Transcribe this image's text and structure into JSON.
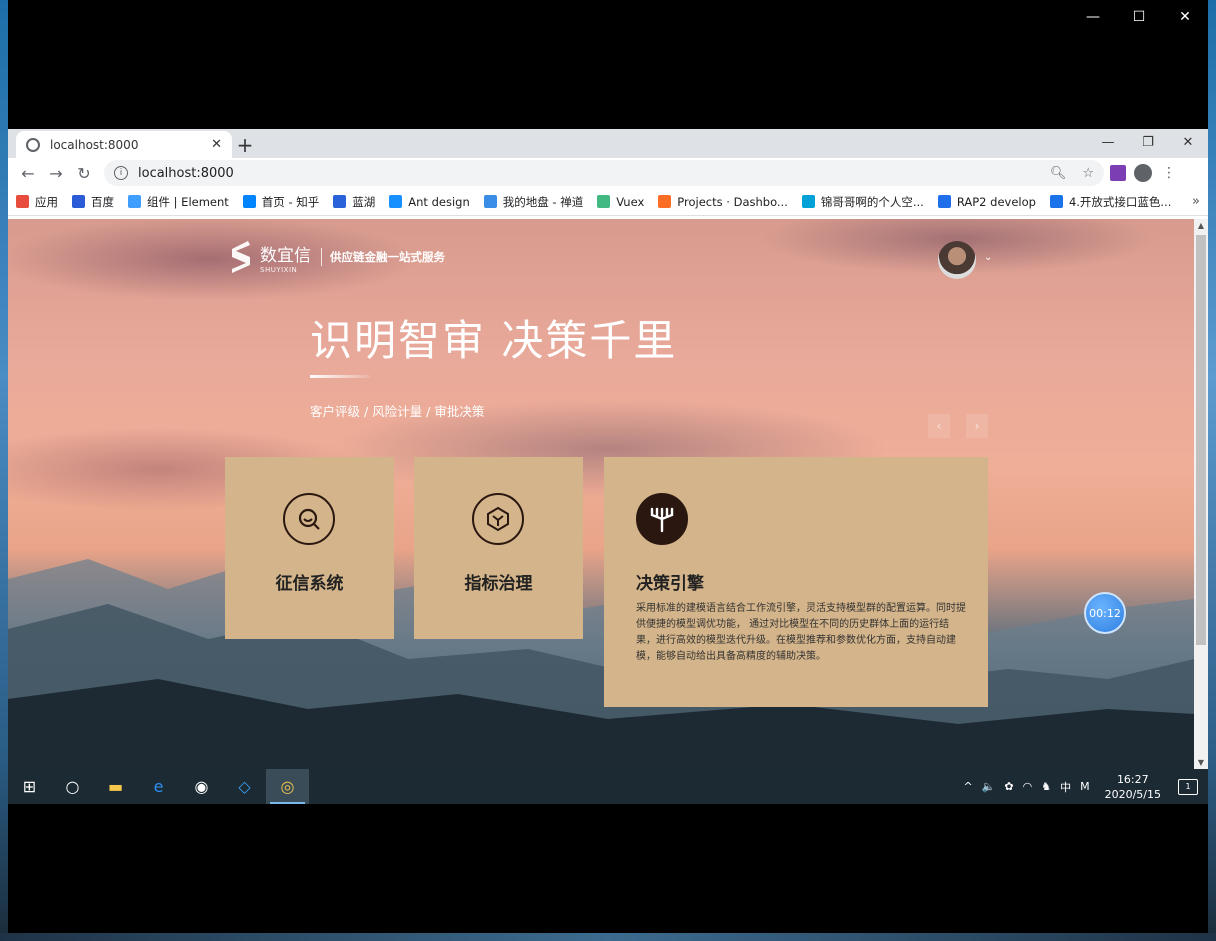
{
  "outer_window": {
    "controls": [
      "—",
      "☐",
      "✕"
    ]
  },
  "browser": {
    "tab_title": "localhost:8000",
    "tab_close": "✕",
    "new_tab": "+",
    "window_controls": [
      "—",
      "❐",
      "✕"
    ],
    "nav": {
      "back": "←",
      "forward": "→",
      "reload": "↻"
    },
    "address": "localhost:8000",
    "info_icon": "i",
    "bookmarks": [
      {
        "label": "应用",
        "color": "#e74c3c",
        "icon": "apps-icon"
      },
      {
        "label": "百度",
        "color": "#2b5bd7",
        "icon": "baidu-icon"
      },
      {
        "label": "组件 | Element",
        "color": "#409eff",
        "icon": "element-icon"
      },
      {
        "label": "首页 - 知乎",
        "color": "#0084ff",
        "icon": "zhihu-icon"
      },
      {
        "label": "蓝湖",
        "color": "#2a63d9",
        "icon": "lanhu-icon"
      },
      {
        "label": "Ant design",
        "color": "#1890ff",
        "icon": "antd-icon"
      },
      {
        "label": "我的地盘 - 禅道",
        "color": "#3a8ee6",
        "icon": "zentao-icon"
      },
      {
        "label": "Vuex",
        "color": "#42b883",
        "icon": "vuex-icon"
      },
      {
        "label": "Projects · Dashbo...",
        "color": "#fc6d26",
        "icon": "gitlab-icon"
      },
      {
        "label": "锦哥哥啊的个人空...",
        "color": "#00a1d6",
        "icon": "bilibili-icon"
      },
      {
        "label": "RAP2 develop",
        "color": "#1f6feb",
        "icon": "rap2-icon"
      },
      {
        "label": "4.开放式接口蓝色...",
        "color": "#1a73e8",
        "icon": "doc-icon"
      }
    ],
    "bookmarks_more": "»"
  },
  "page": {
    "logo_cn": "数宜信",
    "logo_en": "SHUYIXIN",
    "slogan": "供应链金融一站式服务",
    "hero_title": "识明智审 决策千里",
    "hero_subtitle": "客户评级 / 风险计量 / 审批决策",
    "prev_arrow": "‹",
    "next_arrow": "›",
    "avatar_caret": "⌄",
    "cards": [
      {
        "title": "征信系统",
        "icon": "search-credit-icon"
      },
      {
        "title": "指标治理",
        "icon": "cube-icon"
      },
      {
        "title": "决策引擎",
        "icon": "decision-tree-icon",
        "description": "采用标准的建模语言结合工作流引擎，灵活支持模型群的配置运算。同时提供便捷的模型调优功能， 通过对比模型在不同的历史群体上面的运行结果，进行高效的模型迭代升级。在模型推荐和参数优化方面，支持自动建模，能够自动给出具备高精度的辅助决策。"
      }
    ],
    "timer": "00:12"
  },
  "taskbar": {
    "items": [
      {
        "icon": "windows-start-icon",
        "glyph": "⊞"
      },
      {
        "icon": "cortana-icon",
        "glyph": "○"
      },
      {
        "icon": "file-explorer-icon",
        "glyph": "▬"
      },
      {
        "icon": "edge-icon",
        "glyph": "e"
      },
      {
        "icon": "app-avatar-icon",
        "glyph": "◉"
      },
      {
        "icon": "vscode-icon",
        "glyph": "◇"
      },
      {
        "icon": "chrome-icon",
        "glyph": "◎"
      }
    ],
    "tray": [
      "^",
      "🔈",
      "✿",
      "◠",
      "♞",
      "中",
      "M"
    ],
    "time": "16:27",
    "date": "2020/5/15",
    "notification_count": "1"
  }
}
